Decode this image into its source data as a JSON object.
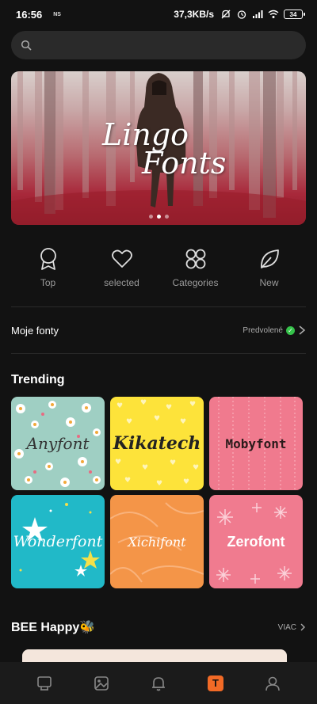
{
  "status_bar": {
    "time": "16:56",
    "network_badge": "NS",
    "speed": "37,3KB/s",
    "battery": "34"
  },
  "search": {
    "placeholder": "",
    "icon": "search-icon"
  },
  "banner": {
    "title_line1": "Lingo",
    "title_line2": "Fonts",
    "slide_count": 3,
    "active_slide": 1
  },
  "quick_nav": [
    {
      "label": "Top",
      "icon": "medal-icon"
    },
    {
      "label": "selected",
      "icon": "heart-icon"
    },
    {
      "label": "Categories",
      "icon": "categories-icon"
    },
    {
      "label": "New",
      "icon": "leaf-icon"
    }
  ],
  "my_fonts": {
    "label": "Moje fonty",
    "default_label": "Predvolené"
  },
  "trending": {
    "title": "Trending",
    "fonts": [
      {
        "name": "Anyfont",
        "color": "#9fcfc3"
      },
      {
        "name": "Kikatech",
        "color": "#fde33a"
      },
      {
        "name": "Mobyfont",
        "color": "#f07a8e"
      },
      {
        "name": "Wonderfont",
        "color": "#21b9c8"
      },
      {
        "name": "Xichifont",
        "color": "#f49548"
      },
      {
        "name": "Zerofont",
        "color": "#f07b8f"
      }
    ]
  },
  "bee_happy": {
    "title": "BEE Happy🐝",
    "more_label": "VIAC"
  },
  "bottom_nav": {
    "items": [
      "keyboard-icon",
      "theme-icon",
      "bell-icon",
      "font-icon",
      "profile-icon"
    ],
    "active_label": "T",
    "accent_color": "#f26a26"
  }
}
